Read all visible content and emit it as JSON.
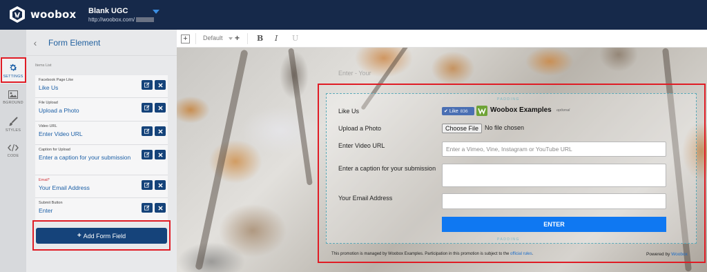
{
  "header": {
    "brand": "woobox",
    "campaign_title": "Blank UGC",
    "campaign_url": "http://woobox.com/"
  },
  "rail": [
    {
      "label": "SETTINGS",
      "icon": "gear-icon",
      "active": true
    },
    {
      "label": "BGROUND",
      "icon": "image-icon",
      "active": false
    },
    {
      "label": "STYLES",
      "icon": "brush-icon",
      "active": false
    },
    {
      "label": "CODE",
      "icon": "code-icon",
      "active": false
    }
  ],
  "panel": {
    "title": "Form Element",
    "items_label": "Items List",
    "items": [
      {
        "category": "Facebook Page Like",
        "value": "Like Us",
        "required": false
      },
      {
        "category": "File Upload",
        "value": "Upload a Photo",
        "required": false
      },
      {
        "category": "Video URL",
        "value": "Enter Video URL",
        "required": false
      },
      {
        "category": "Caption for Upload",
        "value": "Enter a caption for your submission",
        "required": false
      },
      {
        "category": "Email",
        "required_mark": "*",
        "value": "Your Email Address",
        "required": true
      },
      {
        "category": "Submit Button",
        "value": "Enter",
        "required": false
      }
    ],
    "add_button": "Add Form Field"
  },
  "toolbar": {
    "add": "+",
    "style_select": "Default",
    "add_style": "+",
    "bold": "B",
    "italic": "I",
    "underline": "U"
  },
  "canvas": {
    "ghost_title": "Enter - Your",
    "padding_label": "PADDING",
    "form": {
      "like_label": "Like Us",
      "like_button": "Like",
      "like_count": "836",
      "page_name": "Woobox Examples",
      "optional": "optional",
      "upload_label": "Upload a Photo",
      "file_button": "Choose File",
      "file_status": "No file chosen",
      "video_label": "Enter Video URL",
      "video_placeholder": "Enter a Vimeo, Vine, Instagram or YouTube URL",
      "caption_label": "Enter a caption for your submission",
      "email_label": "Your Email Address",
      "submit": "ENTER"
    },
    "footer": {
      "text": "This promotion is managed by Woobox Examples. Participation in this promotion is subject to the",
      "link": "official rules",
      "end": ".",
      "powered_by": "Powered by",
      "powered_link": "Woobox"
    }
  },
  "colors": {
    "topbar": "#16294a",
    "primary_button": "#15437a",
    "submit_button": "#0f78f2",
    "highlight": "#e01b24",
    "link": "#1b5fa6"
  }
}
